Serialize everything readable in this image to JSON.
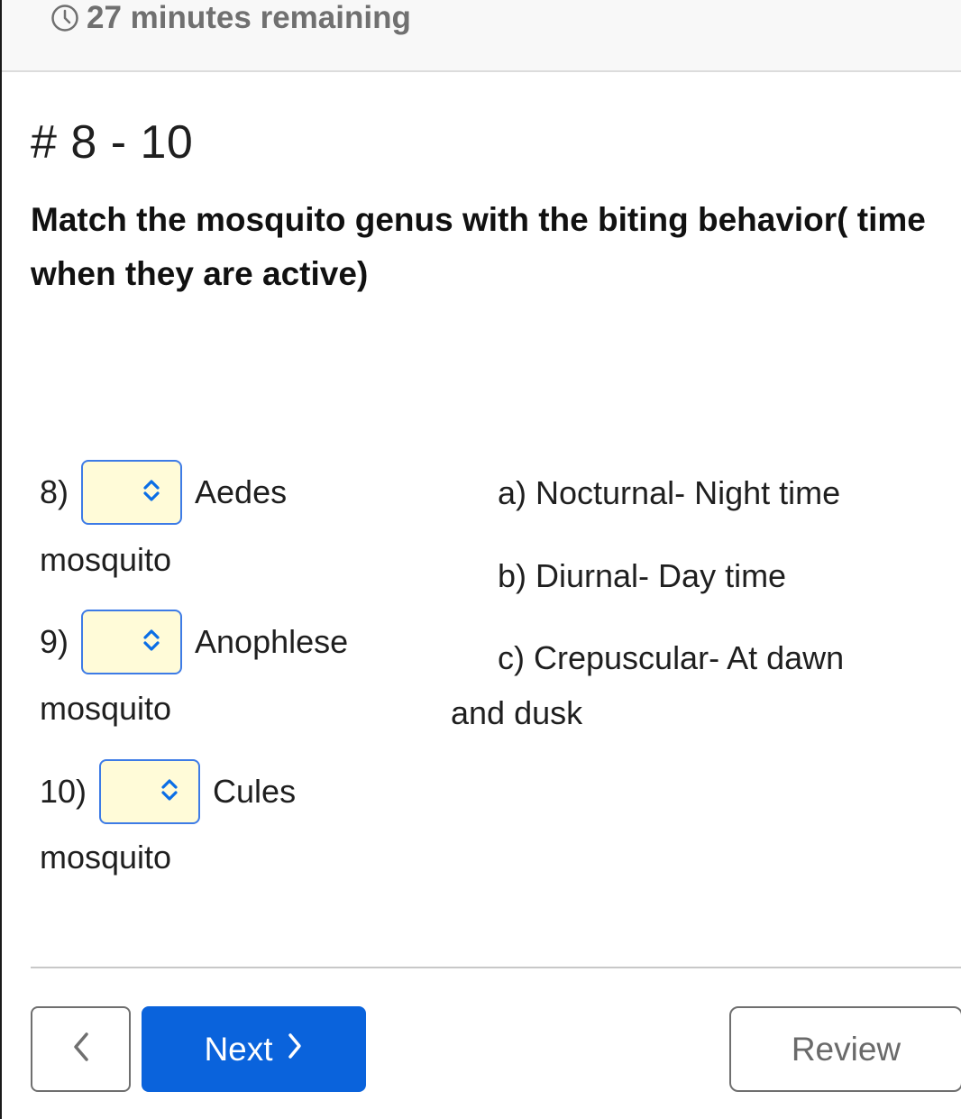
{
  "header": {
    "timer_icon": "clock-icon",
    "timer_text": "27 minutes remaining"
  },
  "question": {
    "range_label": "# 8 - 10",
    "prompt": "Match the mosquito genus with the biting behavior( time when they are active)"
  },
  "items": [
    {
      "number": "8)",
      "genus": "Aedes",
      "suffix": "mosquito",
      "selected": "",
      "dropdown_icon": "chevron-up-down-icon"
    },
    {
      "number": "9)",
      "genus": "Anophlese",
      "suffix": "mosquito",
      "selected": "",
      "dropdown_icon": "chevron-up-down-icon"
    },
    {
      "number": "10)",
      "genus": "Cules",
      "suffix": "mosquito",
      "selected": "",
      "dropdown_icon": "chevron-up-down-icon"
    }
  ],
  "options": [
    {
      "text": "a) Nocturnal- Night time"
    },
    {
      "text": "b) Diurnal- Day time"
    },
    {
      "text": "c) Crepuscular- At dawn",
      "continuation": "and dusk"
    }
  ],
  "colors": {
    "accent": "#0a63dc",
    "select_border": "#3d7be6",
    "select_fill": "#fffbd8",
    "timer_text": "#707070"
  },
  "footer": {
    "prev_icon": "chevron-left-icon",
    "next_label": "Next",
    "next_icon": "chevron-right-icon",
    "review_label": "Review"
  }
}
